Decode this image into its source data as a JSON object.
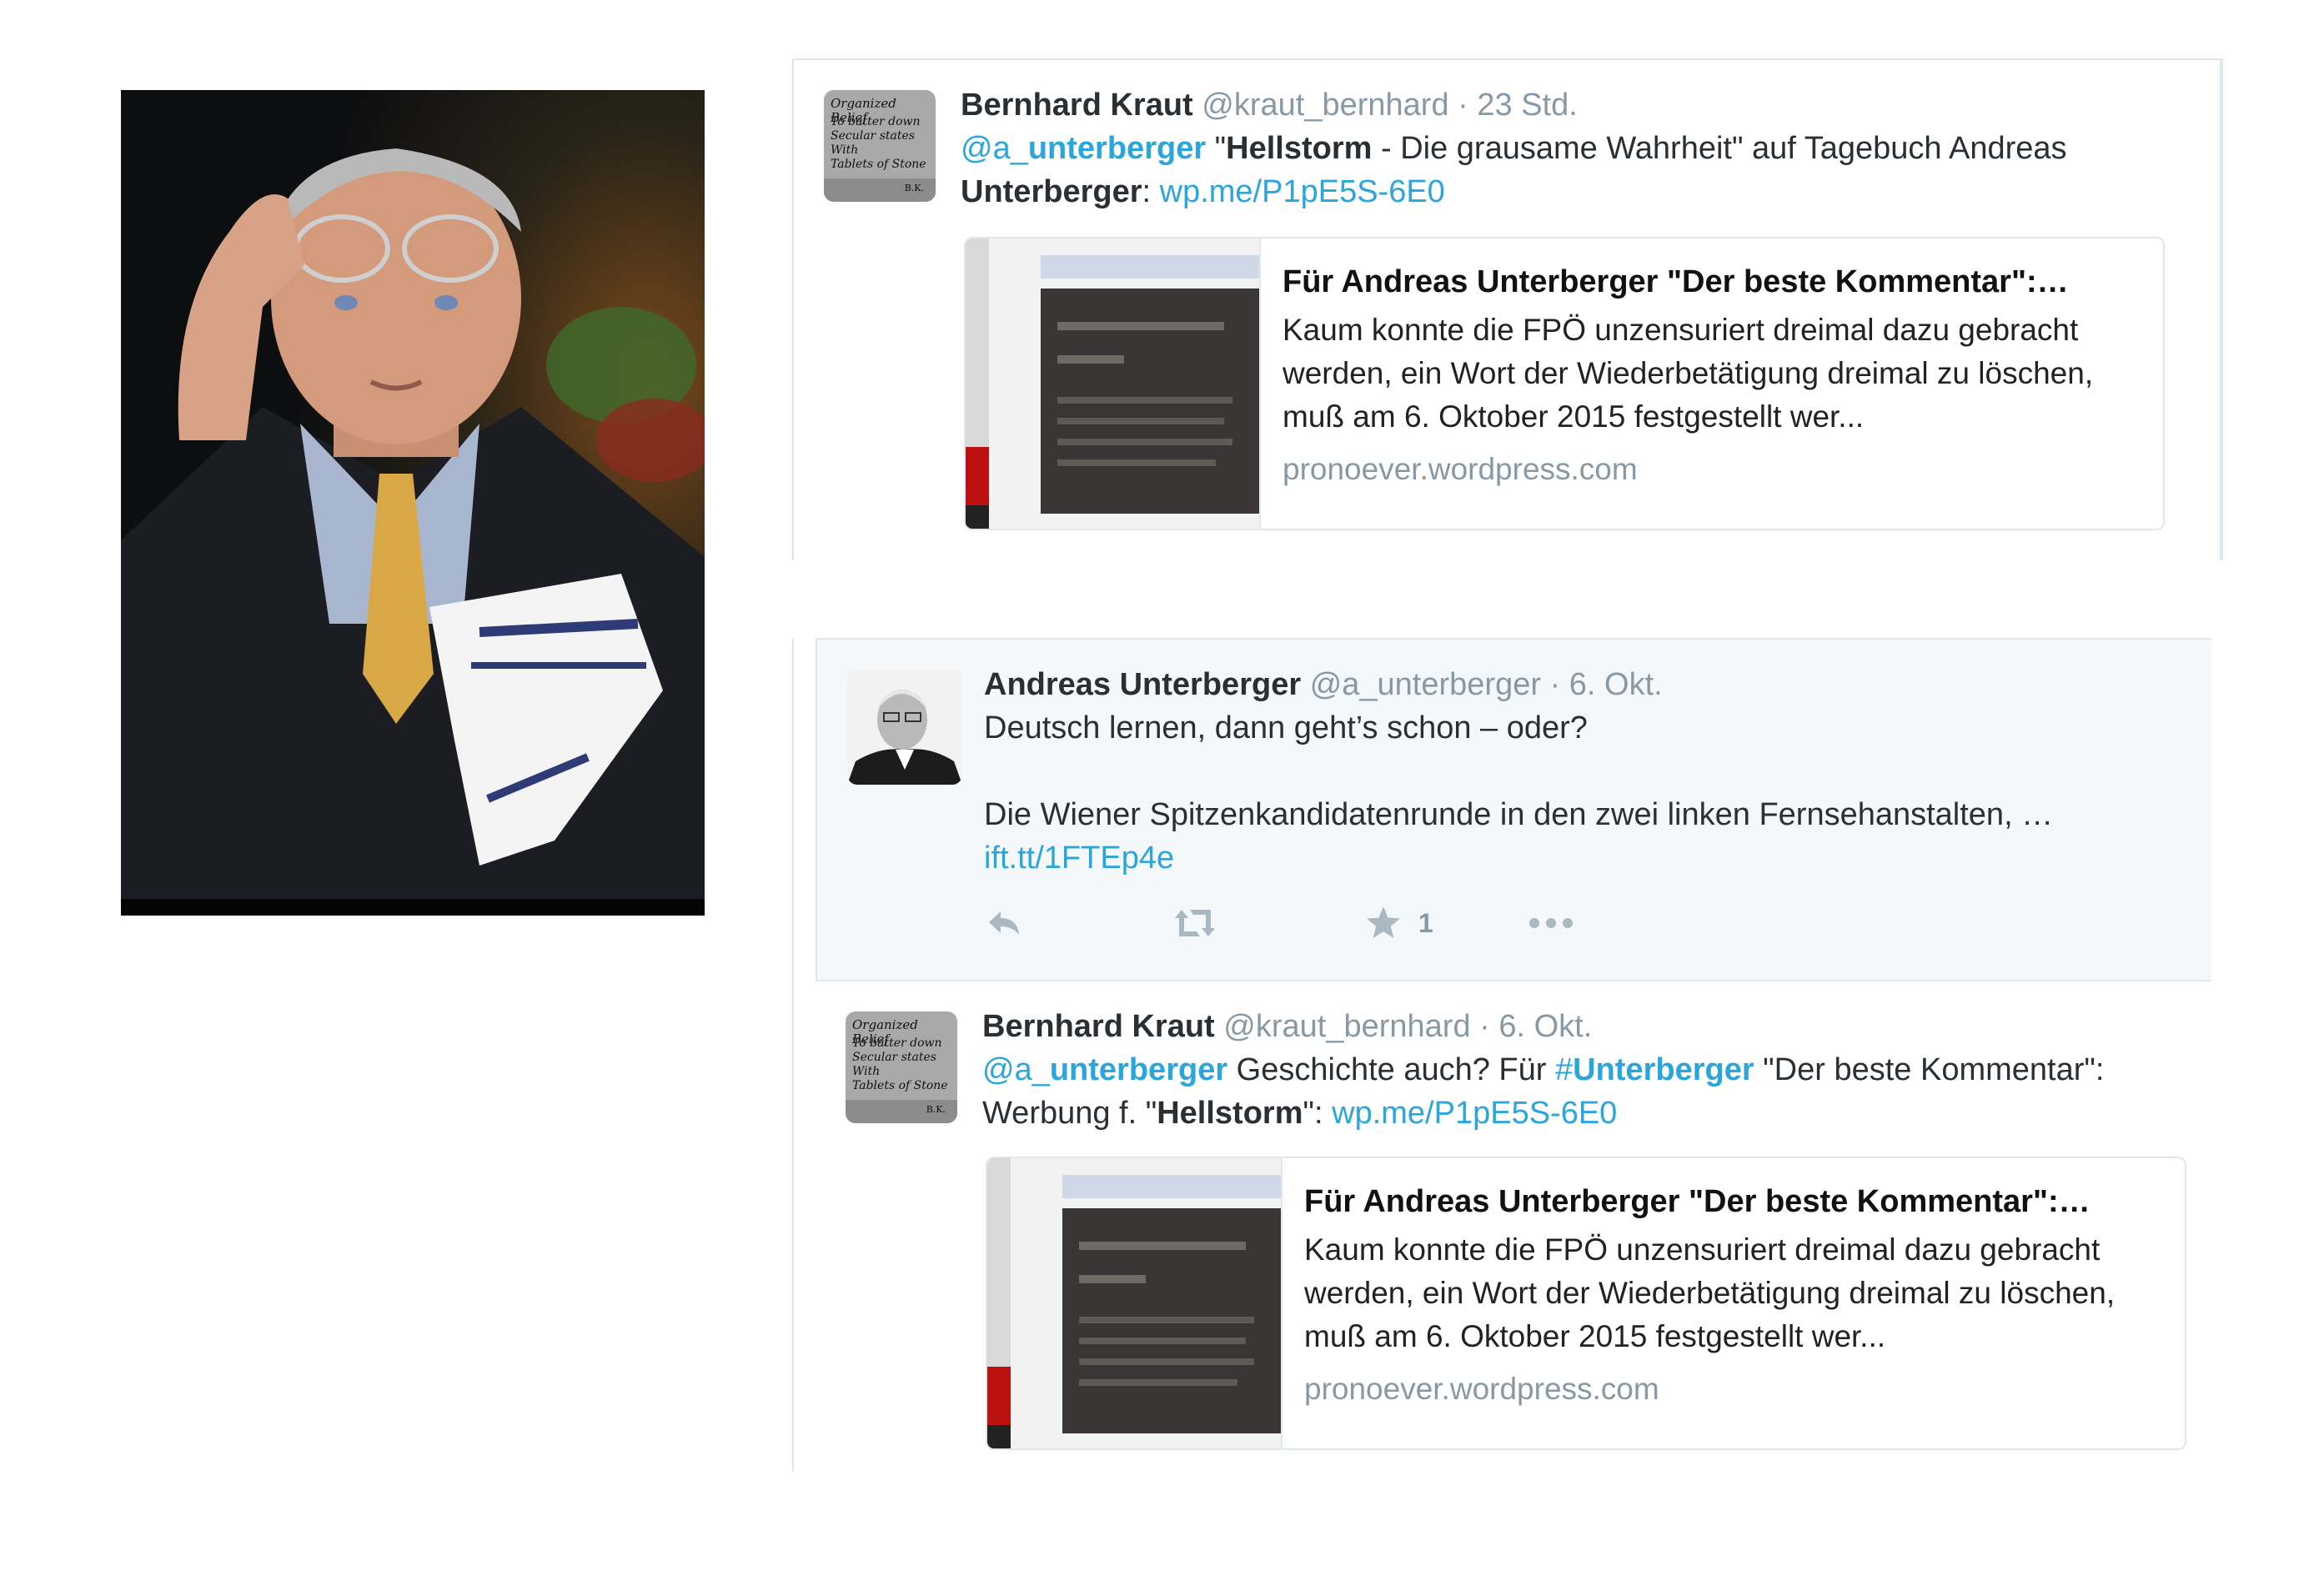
{
  "tweet_top": {
    "avatar_text": {
      "line1": "Organized Belief",
      "lines": [
        "To batter down",
        "Secular states",
        "With",
        "Tablets of Stone"
      ],
      "signature": "B.K."
    },
    "name": "Bernhard Kraut",
    "handle": "@kraut_bernhard",
    "time": "· 23 Std.",
    "mention_prefix": "@a_",
    "mention_bold": "unterberger",
    "quote_open": " \"",
    "bold_hellstorm": "Hellstorm",
    "text_mid": " - Die grausame Wahrheit\" auf Tagebuch Andreas ",
    "bold_unterberger": "Unterberger",
    "colon": ": ",
    "link": "wp.me/P1pE5S-6E0",
    "card": {
      "title": "Für Andreas Unterberger \"Der beste Kommentar\":…",
      "description": "Kaum konnte die FPÖ unzensuriert dreimal dazu gebracht werden, ein Wort der Wiederbetätigung dreimal zu löschen, muß am 6. Oktober 2015 festgestellt wer...",
      "domain": "pronoever.wordpress.com"
    }
  },
  "tweet_au": {
    "name": "Andreas Unterberger",
    "handle": "@a_unterberger",
    "time": "· 6. Okt.",
    "line1": "Deutsch lernen, dann geht’s schon – oder?",
    "line2": "Die Wiener Spitzenkandidatenrunde in den zwei linken Fernsehanstalten, …",
    "link": "ift.tt/1FTEp4e",
    "actions": {
      "reply_icon": "reply-icon",
      "retweet_icon": "retweet-icon",
      "favorite_icon": "star-icon",
      "favorite_count": "1",
      "more_icon": "more-icon"
    }
  },
  "tweet_bk": {
    "avatar_text": {
      "line1": "Organized Belief",
      "lines": [
        "To batter down",
        "Secular states",
        "With",
        "Tablets of Stone"
      ],
      "signature": "B.K."
    },
    "name": "Bernhard Kraut",
    "handle": "@kraut_bernhard",
    "time": "· 6. Okt.",
    "mention_prefix": "@a_",
    "mention_bold": "unterberger",
    "text1": " Geschichte auch? Für ",
    "hashtag_prefix": "#",
    "hashtag_bold": "Unterberger",
    "text2": " \"Der beste Kommentar\": Werbung f. \"",
    "bold_hellstorm": "Hellstorm",
    "text3": "\": ",
    "link": "wp.me/P1pE5S-6E0",
    "card": {
      "title": "Für Andreas Unterberger \"Der beste Kommentar\":…",
      "description": "Kaum konnte die FPÖ unzensuriert dreimal dazu gebracht werden, ein Wort der Wiederbetätigung dreimal zu löschen, muß am 6. Oktober 2015 festgestellt wer...",
      "domain": "pronoever.wordpress.com"
    }
  },
  "colors": {
    "link": "#2aa6dd",
    "meta": "#8899a6",
    "text": "#292f33",
    "border": "#e1e8ed",
    "highlight_bg": "#f5f8fa"
  }
}
